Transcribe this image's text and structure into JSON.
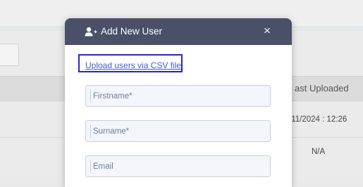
{
  "background": {
    "table_header": "ast Uploaded",
    "row1_date": "/11/2024 : 12:26",
    "row2_value": "N/A"
  },
  "modal": {
    "title": "Add New User",
    "title_icon": "user-plus-icon",
    "close_icon": "close-icon",
    "close_glyph": "×",
    "csv_link": "Upload users via CSV file",
    "fields": {
      "firstname_placeholder": "Firstname*",
      "surname_placeholder": "Surname*",
      "email_placeholder": "Email"
    }
  },
  "colors": {
    "header_bg": "#4a5068",
    "link": "#3f5ed2",
    "highlight_border": "#2c23c9",
    "field_bg": "#f3f6fb"
  }
}
